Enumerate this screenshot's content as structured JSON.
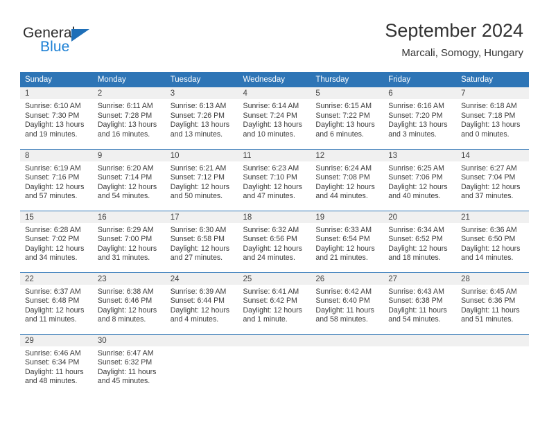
{
  "brand": {
    "name_part1": "General",
    "name_part2": "Blue",
    "accent_color": "#1b7fd4",
    "triangle_color": "#1e6fb8"
  },
  "header": {
    "title": "September 2024",
    "subtitle": "Marcali, Somogy, Hungary"
  },
  "theme": {
    "header_blue": "#2e75b6",
    "daynum_bg": "#f0f0f0",
    "text": "#333333"
  },
  "weekdays": [
    "Sunday",
    "Monday",
    "Tuesday",
    "Wednesday",
    "Thursday",
    "Friday",
    "Saturday"
  ],
  "weeks": [
    [
      {
        "day": "1",
        "sunrise": "Sunrise: 6:10 AM",
        "sunset": "Sunset: 7:30 PM",
        "daylight": "Daylight: 13 hours and 19 minutes."
      },
      {
        "day": "2",
        "sunrise": "Sunrise: 6:11 AM",
        "sunset": "Sunset: 7:28 PM",
        "daylight": "Daylight: 13 hours and 16 minutes."
      },
      {
        "day": "3",
        "sunrise": "Sunrise: 6:13 AM",
        "sunset": "Sunset: 7:26 PM",
        "daylight": "Daylight: 13 hours and 13 minutes."
      },
      {
        "day": "4",
        "sunrise": "Sunrise: 6:14 AM",
        "sunset": "Sunset: 7:24 PM",
        "daylight": "Daylight: 13 hours and 10 minutes."
      },
      {
        "day": "5",
        "sunrise": "Sunrise: 6:15 AM",
        "sunset": "Sunset: 7:22 PM",
        "daylight": "Daylight: 13 hours and 6 minutes."
      },
      {
        "day": "6",
        "sunrise": "Sunrise: 6:16 AM",
        "sunset": "Sunset: 7:20 PM",
        "daylight": "Daylight: 13 hours and 3 minutes."
      },
      {
        "day": "7",
        "sunrise": "Sunrise: 6:18 AM",
        "sunset": "Sunset: 7:18 PM",
        "daylight": "Daylight: 13 hours and 0 minutes."
      }
    ],
    [
      {
        "day": "8",
        "sunrise": "Sunrise: 6:19 AM",
        "sunset": "Sunset: 7:16 PM",
        "daylight": "Daylight: 12 hours and 57 minutes."
      },
      {
        "day": "9",
        "sunrise": "Sunrise: 6:20 AM",
        "sunset": "Sunset: 7:14 PM",
        "daylight": "Daylight: 12 hours and 54 minutes."
      },
      {
        "day": "10",
        "sunrise": "Sunrise: 6:21 AM",
        "sunset": "Sunset: 7:12 PM",
        "daylight": "Daylight: 12 hours and 50 minutes."
      },
      {
        "day": "11",
        "sunrise": "Sunrise: 6:23 AM",
        "sunset": "Sunset: 7:10 PM",
        "daylight": "Daylight: 12 hours and 47 minutes."
      },
      {
        "day": "12",
        "sunrise": "Sunrise: 6:24 AM",
        "sunset": "Sunset: 7:08 PM",
        "daylight": "Daylight: 12 hours and 44 minutes."
      },
      {
        "day": "13",
        "sunrise": "Sunrise: 6:25 AM",
        "sunset": "Sunset: 7:06 PM",
        "daylight": "Daylight: 12 hours and 40 minutes."
      },
      {
        "day": "14",
        "sunrise": "Sunrise: 6:27 AM",
        "sunset": "Sunset: 7:04 PM",
        "daylight": "Daylight: 12 hours and 37 minutes."
      }
    ],
    [
      {
        "day": "15",
        "sunrise": "Sunrise: 6:28 AM",
        "sunset": "Sunset: 7:02 PM",
        "daylight": "Daylight: 12 hours and 34 minutes."
      },
      {
        "day": "16",
        "sunrise": "Sunrise: 6:29 AM",
        "sunset": "Sunset: 7:00 PM",
        "daylight": "Daylight: 12 hours and 31 minutes."
      },
      {
        "day": "17",
        "sunrise": "Sunrise: 6:30 AM",
        "sunset": "Sunset: 6:58 PM",
        "daylight": "Daylight: 12 hours and 27 minutes."
      },
      {
        "day": "18",
        "sunrise": "Sunrise: 6:32 AM",
        "sunset": "Sunset: 6:56 PM",
        "daylight": "Daylight: 12 hours and 24 minutes."
      },
      {
        "day": "19",
        "sunrise": "Sunrise: 6:33 AM",
        "sunset": "Sunset: 6:54 PM",
        "daylight": "Daylight: 12 hours and 21 minutes."
      },
      {
        "day": "20",
        "sunrise": "Sunrise: 6:34 AM",
        "sunset": "Sunset: 6:52 PM",
        "daylight": "Daylight: 12 hours and 18 minutes."
      },
      {
        "day": "21",
        "sunrise": "Sunrise: 6:36 AM",
        "sunset": "Sunset: 6:50 PM",
        "daylight": "Daylight: 12 hours and 14 minutes."
      }
    ],
    [
      {
        "day": "22",
        "sunrise": "Sunrise: 6:37 AM",
        "sunset": "Sunset: 6:48 PM",
        "daylight": "Daylight: 12 hours and 11 minutes."
      },
      {
        "day": "23",
        "sunrise": "Sunrise: 6:38 AM",
        "sunset": "Sunset: 6:46 PM",
        "daylight": "Daylight: 12 hours and 8 minutes."
      },
      {
        "day": "24",
        "sunrise": "Sunrise: 6:39 AM",
        "sunset": "Sunset: 6:44 PM",
        "daylight": "Daylight: 12 hours and 4 minutes."
      },
      {
        "day": "25",
        "sunrise": "Sunrise: 6:41 AM",
        "sunset": "Sunset: 6:42 PM",
        "daylight": "Daylight: 12 hours and 1 minute."
      },
      {
        "day": "26",
        "sunrise": "Sunrise: 6:42 AM",
        "sunset": "Sunset: 6:40 PM",
        "daylight": "Daylight: 11 hours and 58 minutes."
      },
      {
        "day": "27",
        "sunrise": "Sunrise: 6:43 AM",
        "sunset": "Sunset: 6:38 PM",
        "daylight": "Daylight: 11 hours and 54 minutes."
      },
      {
        "day": "28",
        "sunrise": "Sunrise: 6:45 AM",
        "sunset": "Sunset: 6:36 PM",
        "daylight": "Daylight: 11 hours and 51 minutes."
      }
    ],
    [
      {
        "day": "29",
        "sunrise": "Sunrise: 6:46 AM",
        "sunset": "Sunset: 6:34 PM",
        "daylight": "Daylight: 11 hours and 48 minutes."
      },
      {
        "day": "30",
        "sunrise": "Sunrise: 6:47 AM",
        "sunset": "Sunset: 6:32 PM",
        "daylight": "Daylight: 11 hours and 45 minutes."
      },
      {
        "day": "",
        "sunrise": "",
        "sunset": "",
        "daylight": ""
      },
      {
        "day": "",
        "sunrise": "",
        "sunset": "",
        "daylight": ""
      },
      {
        "day": "",
        "sunrise": "",
        "sunset": "",
        "daylight": ""
      },
      {
        "day": "",
        "sunrise": "",
        "sunset": "",
        "daylight": ""
      },
      {
        "day": "",
        "sunrise": "",
        "sunset": "",
        "daylight": ""
      }
    ]
  ]
}
